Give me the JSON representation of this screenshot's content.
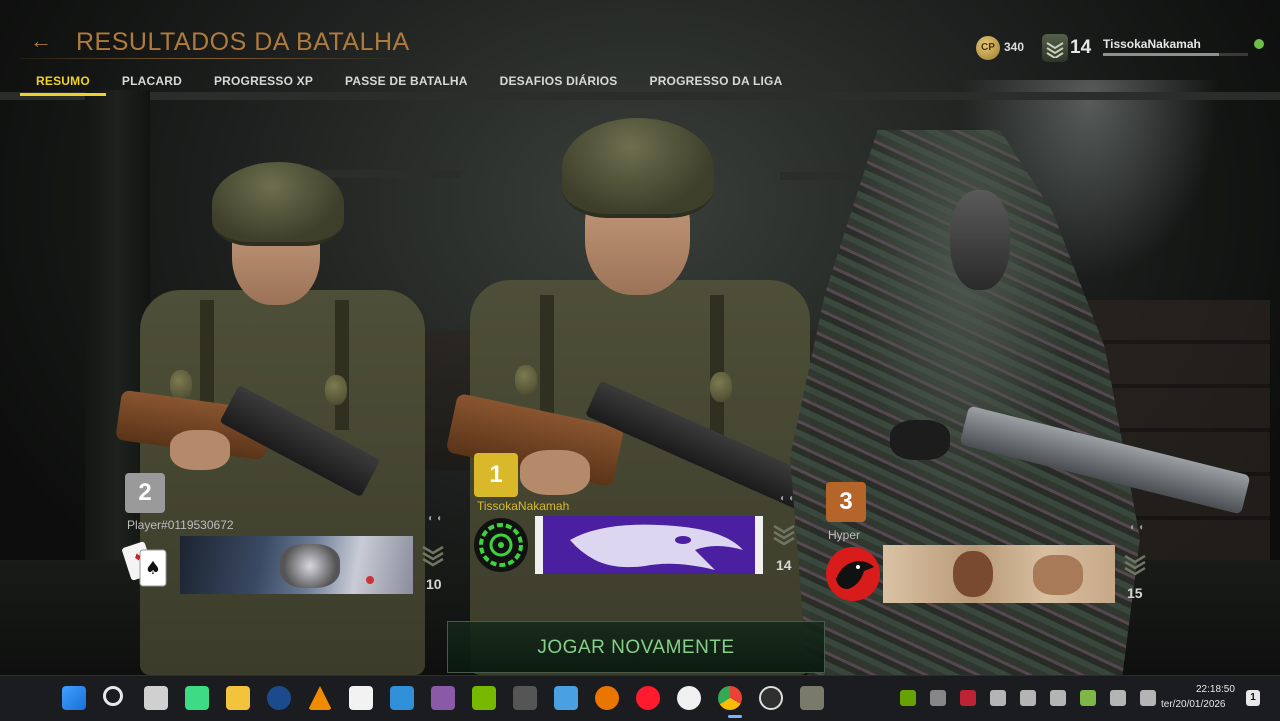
{
  "header": {
    "back_glyph": "←",
    "title": "RESULTADOS DA BATALHA"
  },
  "tabs": [
    {
      "label": "RESUMO",
      "active": true
    },
    {
      "label": "PLACARD",
      "active": false
    },
    {
      "label": "PROGRESSO XP",
      "active": false
    },
    {
      "label": "PASSE DE BATALHA",
      "active": false
    },
    {
      "label": "DESAFIOS DIÁRIOS",
      "active": false
    },
    {
      "label": "PROGRESSO DA LIGA",
      "active": false
    }
  ],
  "account": {
    "cp_label": "CP",
    "cp_amount": "340",
    "level": "14",
    "username": "TissokaNakamah",
    "xp_progress": 0.8,
    "status": "online",
    "status_color": "#6cc04a"
  },
  "players": [
    {
      "place": "2",
      "name": "Player#0119530672",
      "level": "10",
      "place_color": "#9a9a9a",
      "emblem": "playing-cards-emblem",
      "calling_card": "steampunk-calling-card"
    },
    {
      "place": "1",
      "name": "TissokaNakamah",
      "level": "14",
      "place_color": "#d9b92a",
      "emblem": "green-target-emblem",
      "calling_card": "eagle-calling-card"
    },
    {
      "place": "3",
      "name": "Hyper",
      "level": "15",
      "place_color": "#b5642a",
      "emblem": "red-crow-emblem",
      "calling_card": "pinup-calling-card"
    }
  ],
  "actions": {
    "play_again": "JOGAR NOVAMENTE"
  },
  "taskbar": {
    "apps": [
      "windows-start-icon",
      "search-icon",
      "task-view-icon",
      "android-studio-icon",
      "file-explorer-icon",
      "steam-icon",
      "vlc-icon",
      "capcut-icon",
      "app-cube-icon",
      "winrar-icon",
      "nvidia-icon",
      "pen-tool-icon",
      "remote-desktop-icon",
      "blender-icon",
      "opera-icon",
      "unreal-engine-icon",
      "chrome-icon",
      "obs-icon",
      "game-icon"
    ],
    "tray": [
      "nvidia-tray-icon",
      "network-drive-icon",
      "red-app-icon",
      "airplane-icon",
      "steam-tray-icon",
      "usb-icon",
      "microphone-icon",
      "display-icon",
      "volume-icon"
    ],
    "time": "22:18:50",
    "date": "ter/20/01/2026",
    "notification_badge": "1"
  }
}
